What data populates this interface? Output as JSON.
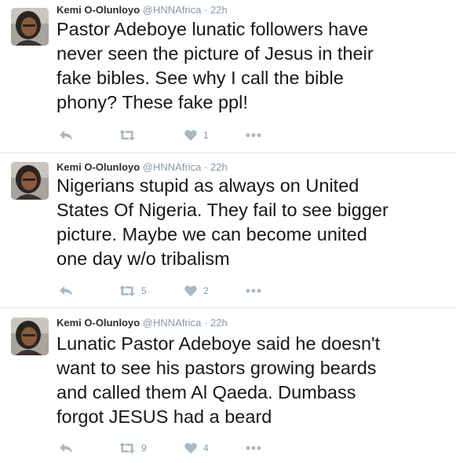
{
  "tweets": [
    {
      "author_name": "Kemi O-Olunloyo",
      "handle": "@HNNAfrica",
      "separator": "·",
      "time": "22h",
      "text_lines": [
        "Pastor Adeboye lunatic followers have",
        "never seen the picture of Jesus in their",
        "fake bibles. See why I call the bible",
        "phony? These fake ppl!"
      ],
      "retweet_count": "",
      "like_count": "1",
      "icons": [
        "reply-icon",
        "retweet-icon",
        "like-icon",
        "more-icon"
      ]
    },
    {
      "author_name": "Kemi O-Olunloyo",
      "handle": "@HNNAfrica",
      "separator": "·",
      "time": "22h",
      "text_lines": [
        "Nigerians stupid as always on United",
        "States Of Nigeria. They fail to see bigger",
        "picture. Maybe we can become united",
        "one day w/o tribalism"
      ],
      "retweet_count": "5",
      "like_count": "2",
      "icons": [
        "reply-icon",
        "retweet-icon",
        "like-icon",
        "more-icon"
      ]
    },
    {
      "author_name": "Kemi O-Olunloyo",
      "handle": "@HNNAfrica",
      "separator": "·",
      "time": "22h",
      "text_lines": [
        "Lunatic Pastor Adeboye said he doesn't",
        "want to see his pastors growing beards",
        "and called them Al Qaeda. Dumbass",
        "forgot JESUS had a beard"
      ],
      "retweet_count": "9",
      "like_count": "4",
      "icons": [
        "reply-icon",
        "retweet-icon",
        "like-icon",
        "more-icon"
      ]
    }
  ],
  "colors": {
    "name": "#292f33",
    "meta": "#8899a6",
    "text": "#14171a",
    "icon": "#aab8c2",
    "divider": "#e1e8ed"
  }
}
